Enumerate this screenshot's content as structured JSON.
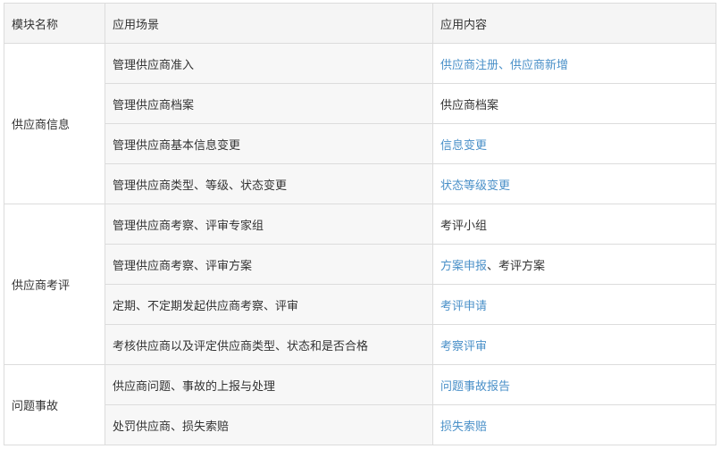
{
  "headers": [
    "模块名称",
    "应用场景",
    "应用内容"
  ],
  "colors": {
    "link": "#4a90c8",
    "text": "#333333",
    "header_bg": "#f5f5f5",
    "border": "#dcdcdc"
  },
  "groups": [
    {
      "module": "供应商信息",
      "rows": [
        {
          "scene": "管理供应商准入",
          "content": [
            {
              "text": "供应商注册、供应商新增",
              "link": true
            }
          ]
        },
        {
          "scene": "管理供应商档案",
          "content": [
            {
              "text": "供应商档案",
              "link": false
            }
          ]
        },
        {
          "scene": "管理供应商基本信息变更",
          "content": [
            {
              "text": "信息变更",
              "link": true
            }
          ]
        },
        {
          "scene": "管理供应商类型、等级、状态变更",
          "content": [
            {
              "text": "状态等级变更",
              "link": true
            }
          ]
        }
      ]
    },
    {
      "module": "供应商考评",
      "rows": [
        {
          "scene": "管理供应商考察、评审专家组",
          "content": [
            {
              "text": "考评小组",
              "link": false
            }
          ]
        },
        {
          "scene": "管理供应商考察、评审方案",
          "content": [
            {
              "text": "方案申报",
              "link": true
            },
            {
              "text": "、考评方案",
              "link": false
            }
          ]
        },
        {
          "scene": "定期、不定期发起供应商考察、评审",
          "content": [
            {
              "text": "考评申请",
              "link": true
            }
          ]
        },
        {
          "scene": "考核供应商以及评定供应商类型、状态和是否合格",
          "content": [
            {
              "text": "考察评审",
              "link": true
            }
          ]
        }
      ]
    },
    {
      "module": "问题事故",
      "rows": [
        {
          "scene": "供应商问题、事故的上报与处理",
          "content": [
            {
              "text": "问题事故报告",
              "link": true
            }
          ]
        },
        {
          "scene": "处罚供应商、损失索赔",
          "content": [
            {
              "text": "损失索赔",
              "link": true
            }
          ]
        }
      ]
    }
  ]
}
